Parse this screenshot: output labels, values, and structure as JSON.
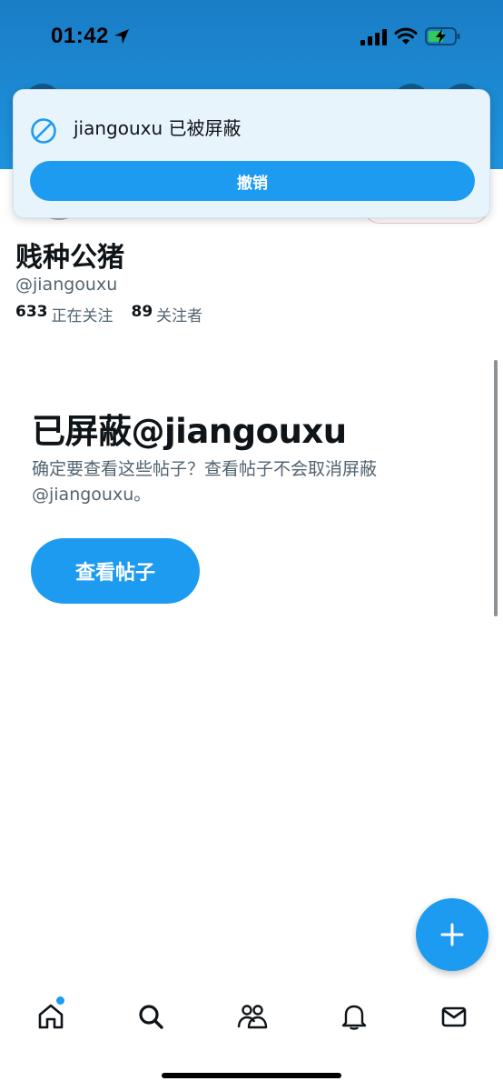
{
  "status_bar": {
    "time": "01:42"
  },
  "toast": {
    "message": "jiangouxu 已被屏蔽",
    "undo_label": "撤销",
    "icon": "blocked-icon"
  },
  "profile": {
    "display_name": "贱种公猪",
    "handle": "@jiangouxu",
    "following_count": "633",
    "following_label": "正在关注",
    "followers_count": "89",
    "followers_label": "关注者"
  },
  "blocked_notice": {
    "title": "已屏蔽@jiangouxu",
    "description": "确定要查看这些帖子？查看帖子不会取消屏蔽 @jiangouxu。",
    "view_button_label": "查看帖子"
  },
  "tabs": [
    {
      "name": "home",
      "icon": "home-icon",
      "has_notification": true
    },
    {
      "name": "search",
      "icon": "search-icon"
    },
    {
      "name": "communities",
      "icon": "communities-icon"
    },
    {
      "name": "notifications",
      "icon": "bell-icon"
    },
    {
      "name": "messages",
      "icon": "mail-icon"
    }
  ],
  "colors": {
    "accent": "#1d9bf0",
    "banner": "#1e90dc",
    "toast_bg": "#e8f4fc",
    "secondary_text": "#536471"
  }
}
